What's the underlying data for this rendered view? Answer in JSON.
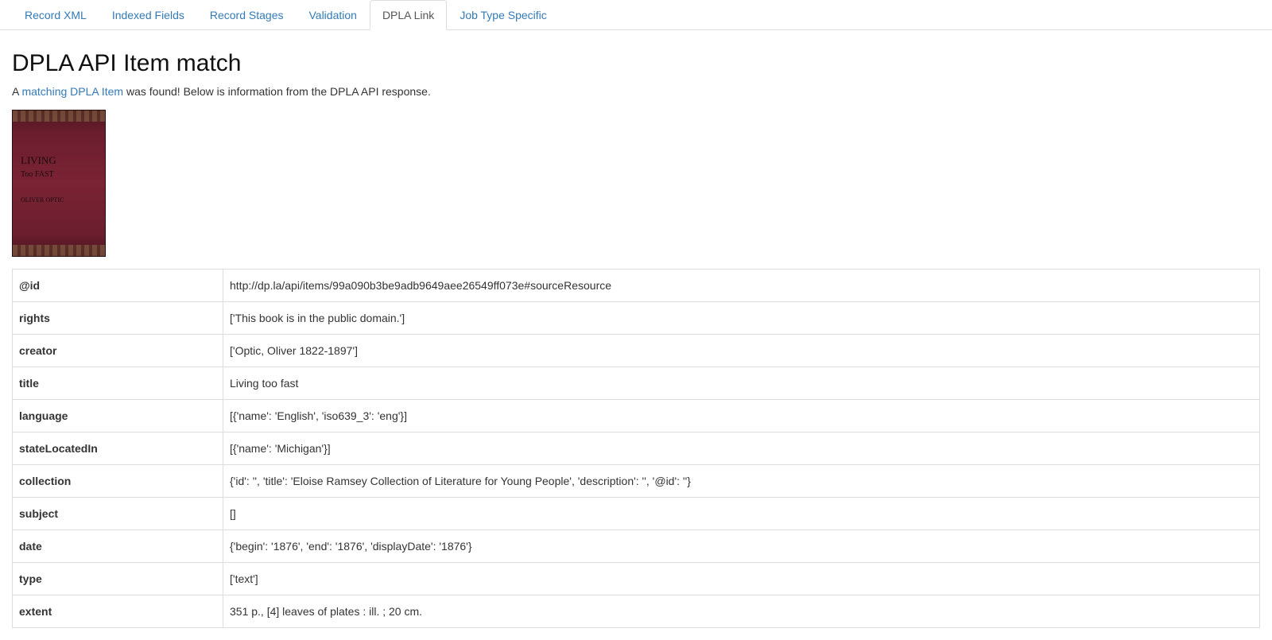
{
  "tabs": [
    {
      "label": "Record XML",
      "active": false
    },
    {
      "label": "Indexed Fields",
      "active": false
    },
    {
      "label": "Record Stages",
      "active": false
    },
    {
      "label": "Validation",
      "active": false
    },
    {
      "label": "DPLA Link",
      "active": true
    },
    {
      "label": "Job Type Specific",
      "active": false
    }
  ],
  "page": {
    "title": "DPLA API Item match",
    "lead_prefix": "A ",
    "lead_link": "matching DPLA Item",
    "lead_suffix": " was found! Below is information from the DPLA API response."
  },
  "cover": {
    "title_line1": "LIVING",
    "title_line2": "Too FAST",
    "author": "OLIVER OPTIC"
  },
  "record": [
    {
      "key": "@id",
      "value": "http://dp.la/api/items/99a090b3be9adb9649aee26549ff073e#sourceResource"
    },
    {
      "key": "rights",
      "value": "['This book is in the public domain.']"
    },
    {
      "key": "creator",
      "value": "['Optic, Oliver 1822-1897']"
    },
    {
      "key": "title",
      "value": "Living too fast"
    },
    {
      "key": "language",
      "value": "[{'name': 'English', 'iso639_3': 'eng'}]"
    },
    {
      "key": "stateLocatedIn",
      "value": "[{'name': 'Michigan'}]"
    },
    {
      "key": "collection",
      "value": "{'id': '', 'title': 'Eloise Ramsey Collection of Literature for Young People', 'description': '', '@id': ''}"
    },
    {
      "key": "subject",
      "value": "[]"
    },
    {
      "key": "date",
      "value": "{'begin': '1876', 'end': '1876', 'displayDate': '1876'}"
    },
    {
      "key": "type",
      "value": "['text']"
    },
    {
      "key": "extent",
      "value": "351 p., [4] leaves of plates : ill. ; 20 cm."
    }
  ]
}
